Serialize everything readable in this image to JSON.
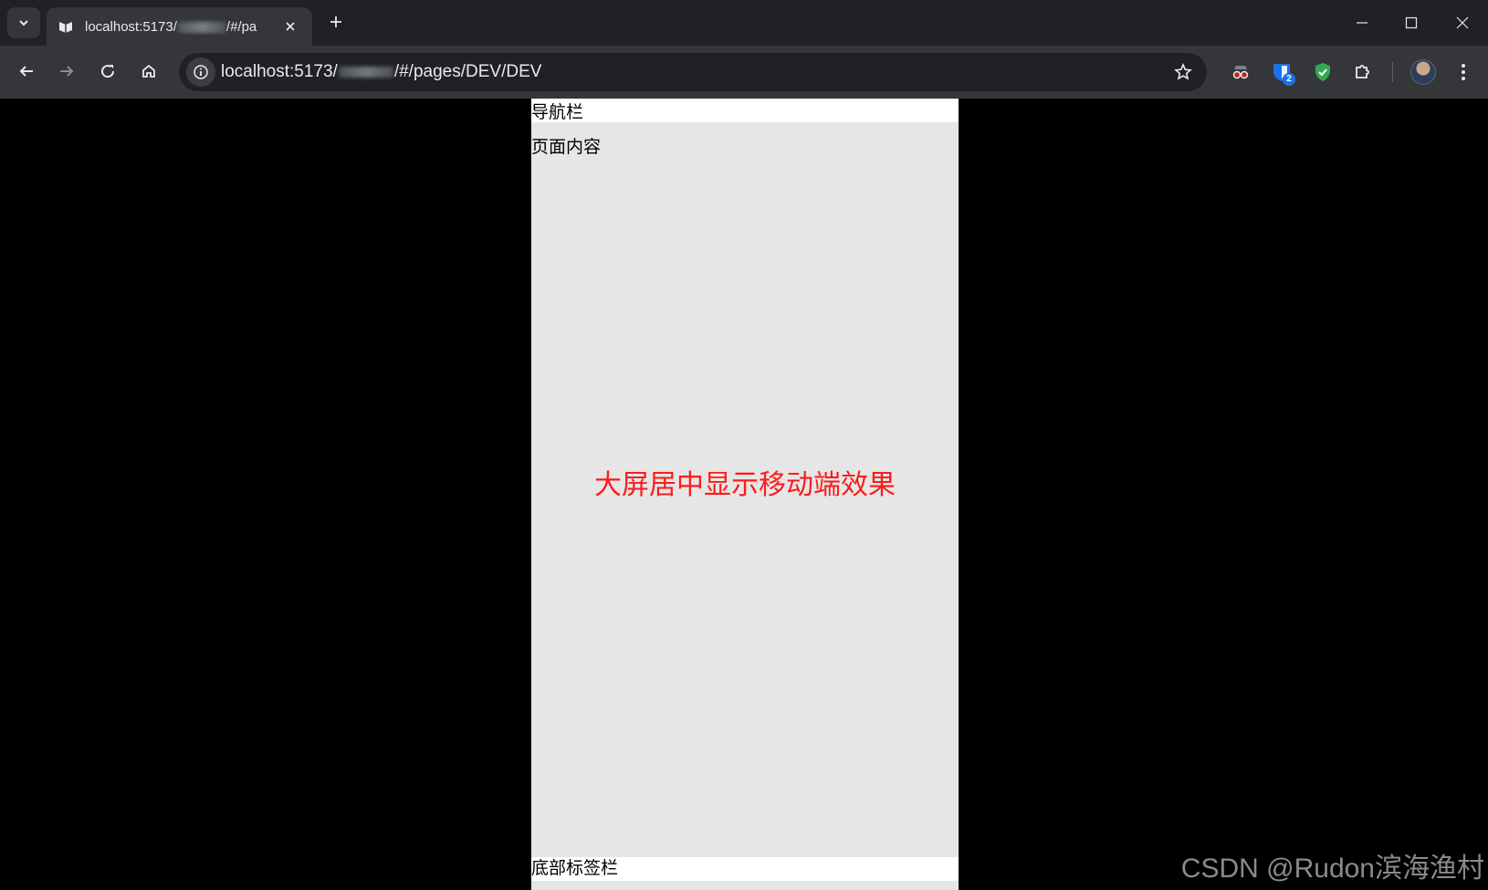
{
  "browser": {
    "tab": {
      "title": "localhost:5173/",
      "title_suffix": "/#/pa"
    },
    "url": {
      "prefix": "localhost:5173/",
      "suffix": "/#/pages/DEV/DEV"
    },
    "extensions": {
      "badge_count": "2"
    },
    "colors": {
      "titlebar": "#202124",
      "toolbar": "#35363a",
      "shield_green": "#34a853",
      "ext_blue": "#1a73e8"
    }
  },
  "page": {
    "navbar_label": "导航栏",
    "content_label": "页面内容",
    "center_text": "大屏居中显示移动端效果",
    "tabbar_label": "底部标签栏",
    "watermark": "CSDN @Rudon滨海渔村",
    "colors": {
      "background": "#000000",
      "phone_background": "#e6e6e6",
      "bars": "#ffffff",
      "center_text": "#ff1a1a"
    }
  }
}
